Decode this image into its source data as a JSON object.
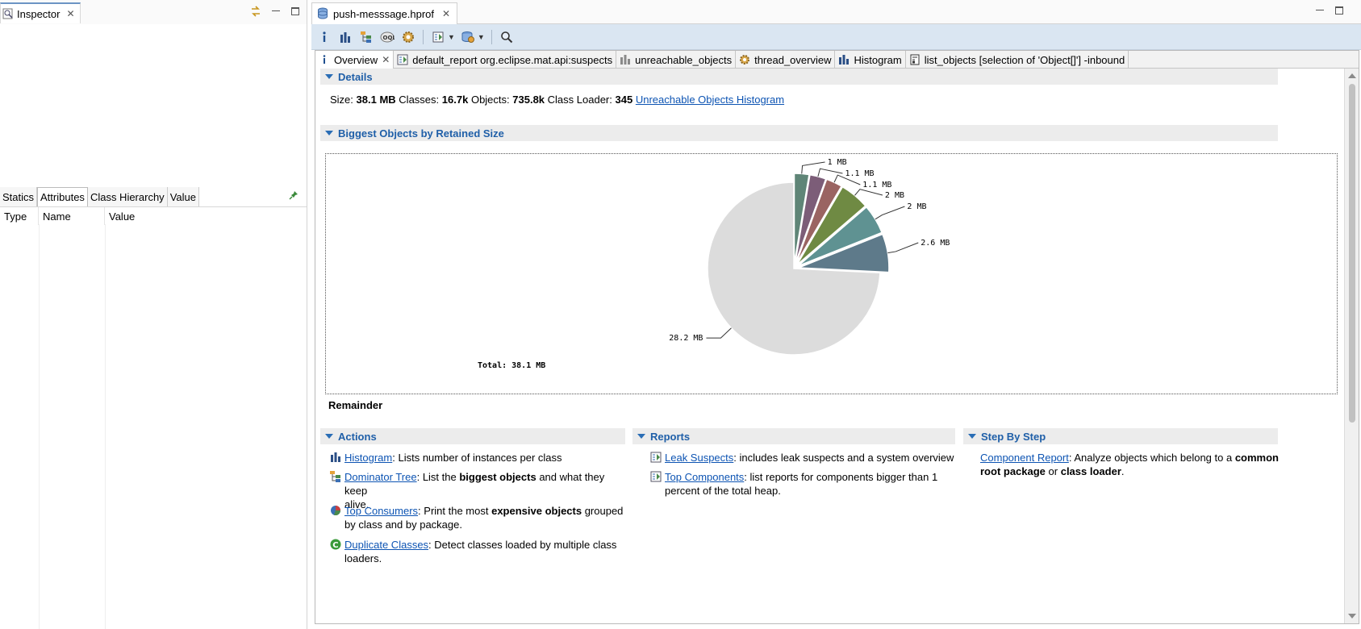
{
  "inspector": {
    "title": "Inspector",
    "tabs": [
      "Statics",
      "Attributes",
      "Class Hierarchy",
      "Value"
    ],
    "active_tab": "Attributes",
    "columns": [
      "Type",
      "Name",
      "Value"
    ]
  },
  "editor": {
    "file_tab": "push-messsage.hprof",
    "sub_tabs": [
      {
        "label": "Overview",
        "icon": "info-icon",
        "closable": true
      },
      {
        "label": "default_report  org.eclipse.mat.api:suspects",
        "icon": "report-icon"
      },
      {
        "label": "unreachable_objects",
        "icon": "histogram-icon"
      },
      {
        "label": "thread_overview",
        "icon": "gears-icon"
      },
      {
        "label": "Histogram",
        "icon": "histogram-icon"
      },
      {
        "label": "list_objects  [selection of 'Object[]'] -inbound",
        "icon": "list-icon"
      }
    ]
  },
  "details": {
    "title": "Details",
    "size_label": "Size:",
    "size_value": "38.1 MB",
    "classes_label": "Classes:",
    "classes_value": "16.7k",
    "objects_label": "Objects:",
    "objects_value": "735.8k",
    "loader_label": "Class Loader:",
    "loader_value": "345",
    "link": "Unreachable Objects Histogram"
  },
  "biggest_objects": {
    "title": "Biggest Objects by Retained Size",
    "total_label": "Total: 38.1 MB",
    "remainder_label": "Remainder"
  },
  "chart_data": {
    "type": "pie",
    "title": "",
    "total": 38.1,
    "slices": [
      {
        "label": "1 MB",
        "value": 1.0,
        "color": "#5f8577"
      },
      {
        "label": "1.1 MB",
        "value": 1.1,
        "color": "#7c5d78"
      },
      {
        "label": "1.1 MB",
        "value": 1.1,
        "color": "#9a6462"
      },
      {
        "label": "2 MB",
        "value": 2.0,
        "color": "#6f8a43"
      },
      {
        "label": "2 MB",
        "value": 2.0,
        "color": "#5f9292"
      },
      {
        "label": "2.6 MB",
        "value": 2.6,
        "color": "#5e7a8a"
      },
      {
        "label": "28.2 MB",
        "value": 28.2,
        "color": "#dcdcdc"
      }
    ]
  },
  "actions": {
    "title": "Actions",
    "items": [
      {
        "link": "Histogram",
        "pre": ": Lists number of instances per class",
        "lines": []
      },
      {
        "link": "Dominator Tree",
        "pre": ": List the ",
        "bold": "biggest objects",
        "post": " and what they keep",
        "line2": "alive."
      },
      {
        "link": "Top Consumers",
        "pre": ": Print the most ",
        "bold": "expensive objects",
        "post": " grouped",
        "line2": "by class and by package."
      },
      {
        "link": "Duplicate Classes",
        "pre": ": Detect classes loaded by multiple class",
        "line2": "loaders."
      }
    ]
  },
  "reports": {
    "title": "Reports",
    "items": [
      {
        "link": "Leak Suspects",
        "pre": ": includes leak suspects and a system overview"
      },
      {
        "link": "Top Components",
        "pre": ": list reports for components bigger than 1",
        "line2": "percent of the total heap."
      }
    ]
  },
  "step_by_step": {
    "title": "Step By Step",
    "link": "Component Report",
    "pre": ": Analyze objects which belong to a ",
    "bold1": "common",
    "bold2": "root package",
    "mid": " or ",
    "bold3": "class loader",
    "end": "."
  }
}
